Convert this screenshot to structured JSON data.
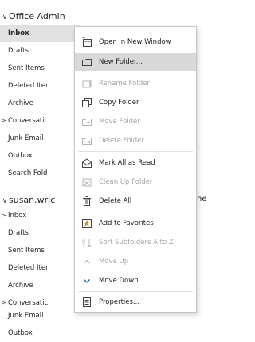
{
  "groups": [
    {
      "header": "Office Admin",
      "folders": [
        {
          "label": "Inbox",
          "selected": true,
          "expandable": false
        },
        {
          "label": "Drafts",
          "selected": false,
          "expandable": false
        },
        {
          "label": "Sent Items",
          "selected": false,
          "expandable": false
        },
        {
          "label": "Deleted Iter",
          "selected": false,
          "expandable": false
        },
        {
          "label": "Archive",
          "selected": false,
          "expandable": false
        },
        {
          "label": "Conversatic",
          "selected": false,
          "expandable": true
        },
        {
          "label": "Junk Email",
          "selected": false,
          "expandable": false
        },
        {
          "label": "Outbox",
          "selected": false,
          "expandable": false
        },
        {
          "label": "Search Fold",
          "selected": false,
          "expandable": false
        }
      ]
    },
    {
      "header": "susan.wric",
      "header_overflow": "ne",
      "folders": [
        {
          "label": "Inbox",
          "selected": false,
          "expandable": true
        },
        {
          "label": "Drafts",
          "selected": false,
          "expandable": false
        },
        {
          "label": "Sent Items",
          "selected": false,
          "expandable": false
        },
        {
          "label": "Deleted Iter",
          "selected": false,
          "expandable": false
        },
        {
          "label": "Archive",
          "selected": false,
          "expandable": false
        },
        {
          "label": "Conversatic",
          "selected": false,
          "expandable": true
        },
        {
          "label": "Junk Email",
          "selected": false,
          "expandable": false
        },
        {
          "label": "Outbox",
          "selected": false,
          "expandable": false
        }
      ]
    }
  ],
  "context_menu": {
    "items": [
      {
        "label": "Open in New Window",
        "icon": "open-window-icon",
        "enabled": true,
        "hover": false
      },
      {
        "label": "New Folder...",
        "icon": "new-folder-icon",
        "enabled": true,
        "hover": true
      },
      {
        "label": "Rename Folder",
        "icon": "rename-folder-icon",
        "enabled": false,
        "hover": false
      },
      {
        "label": "Copy Folder",
        "icon": "copy-folder-icon",
        "enabled": true,
        "hover": false
      },
      {
        "label": "Move Folder",
        "icon": "move-folder-icon",
        "enabled": false,
        "hover": false
      },
      {
        "label": "Delete Folder",
        "icon": "delete-folder-icon",
        "enabled": false,
        "hover": false
      },
      {
        "label": "Mark All as Read",
        "icon": "mark-read-icon",
        "enabled": true,
        "hover": false
      },
      {
        "label": "Clean Up Folder",
        "icon": "clean-up-icon",
        "enabled": false,
        "hover": false
      },
      {
        "label": "Delete All",
        "icon": "delete-all-icon",
        "enabled": true,
        "hover": false
      },
      {
        "label": "Add to Favorites",
        "icon": "favorites-icon",
        "enabled": true,
        "hover": false
      },
      {
        "label": "Sort Subfolders A to Z",
        "icon": "sort-az-icon",
        "enabled": false,
        "hover": false
      },
      {
        "label": "Move Up",
        "icon": "move-up-icon",
        "enabled": false,
        "hover": false
      },
      {
        "label": "Move Down",
        "icon": "move-down-icon",
        "enabled": true,
        "hover": false
      },
      {
        "label": "Properties...",
        "icon": "properties-icon",
        "enabled": true,
        "hover": false
      }
    ]
  },
  "colors": {
    "accent": "#1f5ea8",
    "disabled_text": "#a6a6a6",
    "selected_bg": "#e1e1e1",
    "hover_bg": "#d9d9d9"
  }
}
